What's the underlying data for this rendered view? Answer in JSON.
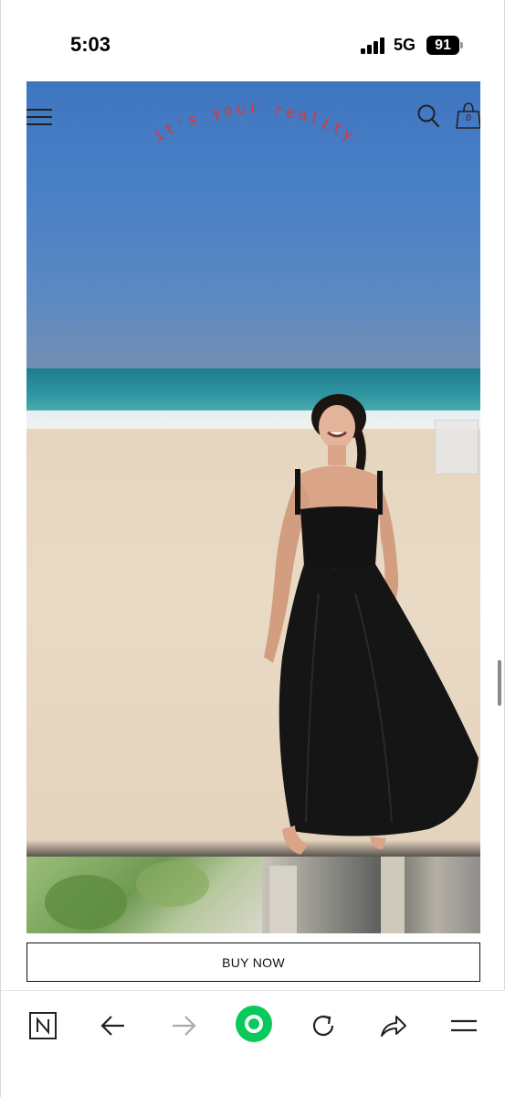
{
  "status_bar": {
    "time": "5:03",
    "network": "5G",
    "battery": "91"
  },
  "site": {
    "tagline": "it's your reality",
    "tagline_color": "#d8383c",
    "cart_count": "0"
  },
  "hero": {
    "image": "woman in black dress on beach"
  },
  "buy_button": {
    "label": "BUY NOW"
  },
  "browser_toolbar": {
    "items": [
      "naver-logo-icon",
      "back-arrow-icon",
      "forward-arrow-icon",
      "green-home-icon",
      "reload-icon",
      "share-icon",
      "menu-icon"
    ],
    "accent": "#08c95a"
  }
}
